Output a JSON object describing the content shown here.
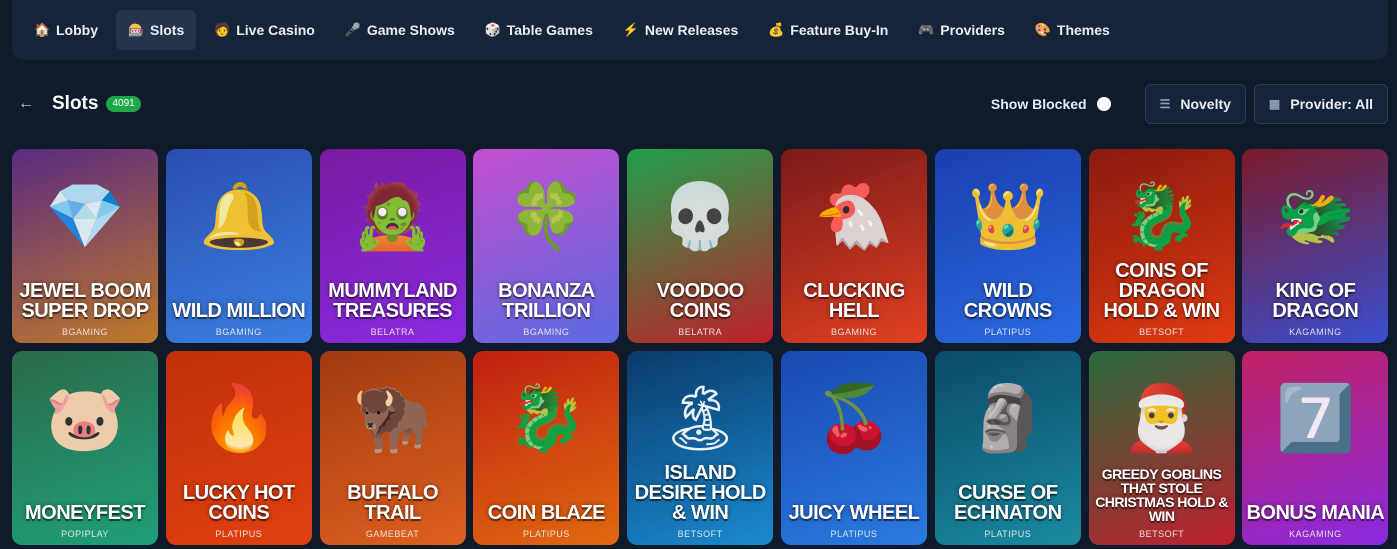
{
  "nav": {
    "items": [
      {
        "label": "Lobby",
        "icon": "🏠",
        "icon_name": "house-icon",
        "active": false
      },
      {
        "label": "Slots",
        "icon": "🎰",
        "icon_name": "slot-machine-icon",
        "active": true
      },
      {
        "label": "Live Casino",
        "icon": "🧑",
        "icon_name": "dealer-icon",
        "active": false
      },
      {
        "label": "Game Shows",
        "icon": "🎤",
        "icon_name": "microphone-icon",
        "active": false
      },
      {
        "label": "Table Games",
        "icon": "🎲",
        "icon_name": "dice-icon",
        "active": false
      },
      {
        "label": "New Releases",
        "icon": "⚡",
        "icon_name": "lightning-icon",
        "active": false
      },
      {
        "label": "Feature Buy-In",
        "icon": "💰",
        "icon_name": "money-icon",
        "active": false
      },
      {
        "label": "Providers",
        "icon": "🎮",
        "icon_name": "gamepad-icon",
        "active": false
      },
      {
        "label": "Themes",
        "icon": "🎨",
        "icon_name": "palette-icon",
        "active": false
      }
    ]
  },
  "header": {
    "back_icon": "←",
    "title": "Slots",
    "count": "4091",
    "show_blocked_label": "Show Blocked",
    "sort_label": "Novelty",
    "sort_icon": "☰",
    "provider_label": "Provider: All",
    "provider_icon": "▦"
  },
  "games": [
    {
      "title": "JEWEL BOOM SUPER DROP",
      "provider": "BGAMING",
      "art": "💎",
      "color1": "#5a2a80",
      "color2": "#c07a2a"
    },
    {
      "title": "WILD MILLION",
      "provider": "BGAMING",
      "art": "🔔",
      "color1": "#2a4fb0",
      "color2": "#3a7fe0"
    },
    {
      "title": "MUMMYLAND TREASURES",
      "provider": "BELATRA",
      "art": "🧟",
      "color1": "#7a1aa0",
      "color2": "#8a2be2"
    },
    {
      "title": "BONANZA TRILLION",
      "provider": "BGAMING",
      "art": "🍀",
      "color1": "#c44fd0",
      "color2": "#5a6ae0"
    },
    {
      "title": "VOODOO COINS",
      "provider": "BELATRA",
      "art": "💀",
      "color1": "#1fa04a",
      "color2": "#c0202a"
    },
    {
      "title": "CLUCKING HELL",
      "provider": "BGAMING",
      "art": "🐔",
      "color1": "#7a1a1a",
      "color2": "#e04020"
    },
    {
      "title": "WILD CROWNS",
      "provider": "PLATIPUS",
      "art": "👑",
      "color1": "#1a3fb0",
      "color2": "#2a6ae0"
    },
    {
      "title": "COINS OF DRAGON HOLD & WIN",
      "provider": "BETSOFT",
      "art": "🐉",
      "color1": "#8a1a10",
      "color2": "#e03a10"
    },
    {
      "title": "KING OF DRAGON",
      "provider": "KAGAMING",
      "art": "🐲",
      "color1": "#7a1a2a",
      "color2": "#3a4fd0"
    },
    {
      "title": "MONEYFEST",
      "provider": "POPIPLAY",
      "art": "🐷",
      "color1": "#2a6a4a",
      "color2": "#1fa07a"
    },
    {
      "title": "LUCKY HOT COINS",
      "provider": "PLATIPUS",
      "art": "🔥",
      "color1": "#c0300a",
      "color2": "#e04010"
    },
    {
      "title": "BUFFALO TRAIL",
      "provider": "GAMEBEAT",
      "art": "🦬",
      "color1": "#a03a10",
      "color2": "#e06020"
    },
    {
      "title": "COIN BLAZE",
      "provider": "PLATIPUS",
      "art": "🐉",
      "color1": "#c02010",
      "color2": "#e06a10"
    },
    {
      "title": "ISLAND DESIRE HOLD & WIN",
      "provider": "BETSOFT",
      "art": "🏝",
      "color1": "#0a3a6a",
      "color2": "#1a8ad0"
    },
    {
      "title": "JUICY WHEEL",
      "provider": "PLATIPUS",
      "art": "🍒",
      "color1": "#1a4ab0",
      "color2": "#2a7ae0"
    },
    {
      "title": "CURSE OF ECHNATON",
      "provider": "PLATIPUS",
      "art": "🗿",
      "color1": "#0a4a6a",
      "color2": "#1a8aa0"
    },
    {
      "title": "GREEDY GOBLINS THAT STOLE CHRISTMAS HOLD & WIN",
      "provider": "BETSOFT",
      "art": "🎅",
      "color1": "#2a6a3a",
      "color2": "#c02030"
    },
    {
      "title": "BONUS MANIA",
      "provider": "KAGAMING",
      "art": "7️⃣",
      "color1": "#c02060",
      "color2": "#8a2ae0"
    }
  ]
}
